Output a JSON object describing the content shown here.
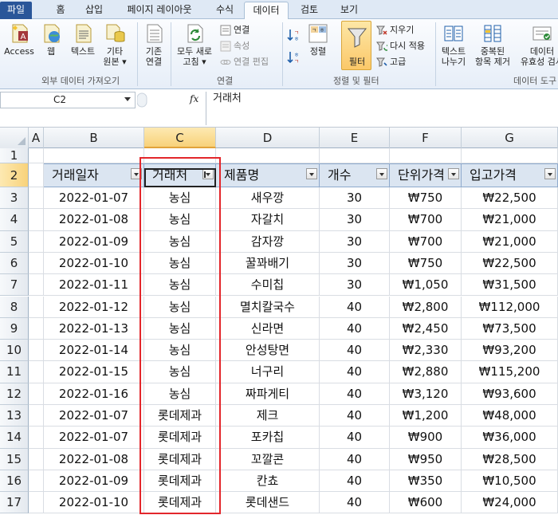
{
  "ribbon_tabs": [
    "파일",
    "홈",
    "삽입",
    "페이지 레이아웃",
    "수식",
    "데이터",
    "검토",
    "보기"
  ],
  "active_tab": "데이터",
  "ribbon": {
    "access": "Access",
    "web": "웹",
    "text": "텍스트",
    "other_sources_1": "기타",
    "other_sources_2": "원본 ▾",
    "existing_1": "기존",
    "existing_2": "연결",
    "refresh_1": "모두 새로",
    "refresh_2": "고침 ▾",
    "connections": "연결",
    "properties": "속성",
    "edit_links": "연결 편집",
    "sort": "정렬",
    "filter": "필터",
    "clear": "지우기",
    "reapply": "다시 적용",
    "advanced": "고급",
    "text_to_columns_1": "텍스트",
    "text_to_columns_2": "나누기",
    "remove_dup_1": "중복된",
    "remove_dup_2": "항목 제거",
    "validation_1": "데이터",
    "validation_2": "유효성 검사",
    "group_external": "외부 데이터 가져오기",
    "group_connections": "연결",
    "group_sort_filter": "정렬 및 필터",
    "group_data_tools": "데이터 도구"
  },
  "formula_bar": {
    "name_box": "C2",
    "fx": "fx",
    "content": "거래처"
  },
  "columns": [
    "A",
    "B",
    "C",
    "D",
    "E",
    "F",
    "G"
  ],
  "row_numbers": [
    "1",
    "2",
    "3",
    "4",
    "5",
    "6",
    "7",
    "8",
    "9",
    "10",
    "11",
    "12",
    "13",
    "14",
    "15",
    "16",
    "17"
  ],
  "table": {
    "headers": [
      "거래일자",
      "거래처",
      "제품명",
      "개수",
      "단위가격",
      "입고가격"
    ],
    "rows": [
      [
        "2022-01-07",
        "농심",
        "새우깡",
        "30",
        "₩750",
        "₩22,500"
      ],
      [
        "2022-01-08",
        "농심",
        "자갈치",
        "30",
        "₩700",
        "₩21,000"
      ],
      [
        "2022-01-09",
        "농심",
        "감자깡",
        "30",
        "₩700",
        "₩21,000"
      ],
      [
        "2022-01-10",
        "농심",
        "꿀꽈배기",
        "30",
        "₩750",
        "₩22,500"
      ],
      [
        "2022-01-11",
        "농심",
        "수미칩",
        "30",
        "₩1,050",
        "₩31,500"
      ],
      [
        "2022-01-12",
        "농심",
        "멸치칼국수",
        "40",
        "₩2,800",
        "₩112,000"
      ],
      [
        "2022-01-13",
        "농심",
        "신라면",
        "40",
        "₩2,450",
        "₩73,500"
      ],
      [
        "2022-01-14",
        "농심",
        "안성탕면",
        "40",
        "₩2,330",
        "₩93,200"
      ],
      [
        "2022-01-15",
        "농심",
        "너구리",
        "40",
        "₩2,880",
        "₩115,200"
      ],
      [
        "2022-01-16",
        "농심",
        "짜파게티",
        "40",
        "₩3,120",
        "₩93,600"
      ],
      [
        "2022-01-07",
        "롯데제과",
        "제크",
        "40",
        "₩1,200",
        "₩48,000"
      ],
      [
        "2022-01-07",
        "롯데제과",
        "포카칩",
        "40",
        "₩900",
        "₩36,000"
      ],
      [
        "2022-01-08",
        "롯데제과",
        "꼬깔콘",
        "40",
        "₩950",
        "₩28,500"
      ],
      [
        "2022-01-09",
        "롯데제과",
        "칸쵸",
        "40",
        "₩350",
        "₩10,500"
      ],
      [
        "2022-01-10",
        "롯데제과",
        "롯데샌드",
        "40",
        "₩600",
        "₩24,000"
      ]
    ]
  },
  "colors": {
    "file_tab": "#2a5699",
    "selection_header": "#f8d27a",
    "table_header_fill": "#dbe5f1",
    "highlight_box": "#e3262b"
  }
}
